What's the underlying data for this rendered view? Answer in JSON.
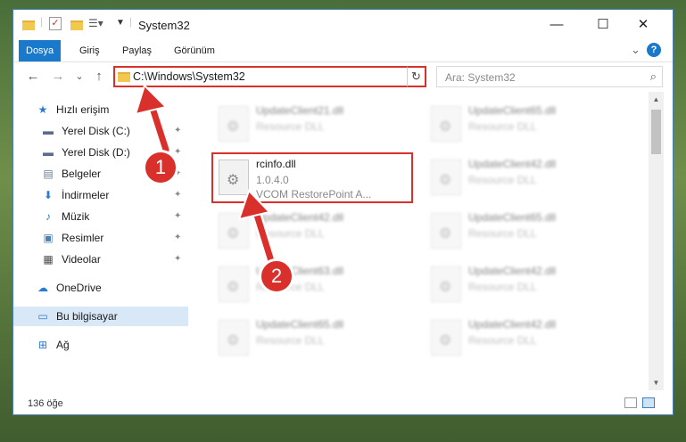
{
  "window": {
    "title": "System32",
    "controls": {
      "minimize": "—",
      "maximize": "☐",
      "close": "✕"
    }
  },
  "ribbon": {
    "tabs": [
      "Dosya",
      "Giriş",
      "Paylaş",
      "Görünüm"
    ],
    "active_tab": "Dosya",
    "help_label": "?",
    "expand_glyph": "⌄"
  },
  "nav": {
    "back": "←",
    "forward": "→",
    "recent": "⌄",
    "up": "↑",
    "address_path": "C:\\Windows\\System32",
    "refresh": "↻",
    "search_placeholder": "Ara: System32",
    "search_icon": "search-icon"
  },
  "sidebar": {
    "items": [
      {
        "label": "Hızlı erişim",
        "icon": "star-icon",
        "glyph": "★",
        "color": "#2a7bd0",
        "pinned": false,
        "indent": 0
      },
      {
        "label": "Yerel Disk (C:)",
        "icon": "drive-icon",
        "glyph": "▬",
        "color": "#5a6f87",
        "pinned": true,
        "indent": 1
      },
      {
        "label": "Yerel Disk (D:)",
        "icon": "drive-icon",
        "glyph": "▬",
        "color": "#5a6f87",
        "pinned": true,
        "indent": 1
      },
      {
        "label": "Belgeler",
        "icon": "documents-icon",
        "glyph": "▤",
        "color": "#6b7d91",
        "pinned": true,
        "indent": 1
      },
      {
        "label": "İndirmeler",
        "icon": "downloads-icon",
        "glyph": "⬇",
        "color": "#2a7bd0",
        "pinned": true,
        "indent": 1
      },
      {
        "label": "Müzik",
        "icon": "music-icon",
        "glyph": "♪",
        "color": "#2a7bd0",
        "pinned": true,
        "indent": 1
      },
      {
        "label": "Resimler",
        "icon": "pictures-icon",
        "glyph": "▣",
        "color": "#4f7fae",
        "pinned": true,
        "indent": 1
      },
      {
        "label": "Videolar",
        "icon": "videos-icon",
        "glyph": "▦",
        "color": "#4a4a4a",
        "pinned": true,
        "indent": 1
      },
      {
        "label": "OneDrive",
        "icon": "onedrive-icon",
        "glyph": "☁",
        "color": "#2a7bd0",
        "pinned": false,
        "indent": 0
      },
      {
        "label": "Bu bilgisayar",
        "icon": "computer-icon",
        "glyph": "▭",
        "color": "#2a7bd0",
        "pinned": false,
        "indent": 0,
        "selected": true
      },
      {
        "label": "Ağ",
        "icon": "network-icon",
        "glyph": "⊞",
        "color": "#2a7bd0",
        "pinned": false,
        "indent": 0
      }
    ],
    "pin_glyph": "📌"
  },
  "files": [
    {
      "name": "UpdateClient21.dll",
      "desc": "Resource DLL",
      "version": "",
      "blurred": true
    },
    {
      "name": "UpdateClient65.dll",
      "desc": "Resource DLL",
      "version": "",
      "blurred": true
    },
    {
      "name": "rcinfo.dll",
      "version": "1.0.4.0",
      "desc": "VCOM RestorePoint A...",
      "blurred": false
    },
    {
      "name": "UpdateClient42.dll",
      "desc": "Resource DLL",
      "version": "",
      "blurred": true
    },
    {
      "name": "UpdateClient42.dll",
      "desc": "Resource DLL",
      "version": "",
      "blurred": true
    },
    {
      "name": "UpdateClient65.dll",
      "desc": "Resource DLL",
      "version": "",
      "blurred": true
    },
    {
      "name": "UpdateClient63.dll",
      "desc": "Resource DLL",
      "version": "",
      "blurred": true
    },
    {
      "name": "UpdateClient42.dll",
      "desc": "Resource DLL",
      "version": "",
      "blurred": true
    },
    {
      "name": "UpdateClient65.dll",
      "desc": "Resource DLL",
      "version": "",
      "blurred": true
    },
    {
      "name": "UpdateClient42.dll",
      "desc": "Resource DLL",
      "version": "",
      "blurred": true
    }
  ],
  "status": {
    "item_count": "136 öğe"
  },
  "callouts": [
    "1",
    "2"
  ],
  "colors": {
    "accent": "#1979ca",
    "highlight": "#d9302c",
    "selected_bg": "#d9e8f7"
  }
}
